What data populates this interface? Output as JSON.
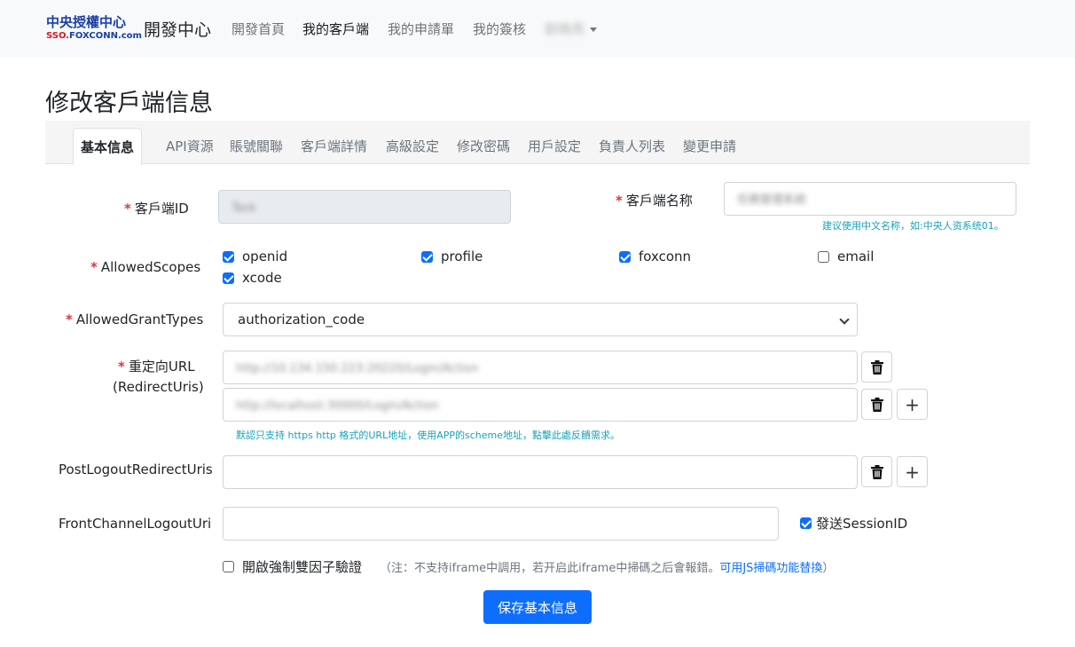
{
  "navbar": {
    "logo_line1": "中央授權中心",
    "logo_sso": "SSO.",
    "logo_domain": "FOXCONN.com",
    "brand": "開發中心",
    "links": [
      "開發首頁",
      "我的客戶端",
      "我的申請單",
      "我的簽核"
    ],
    "user": "劉曉燕"
  },
  "page_title": "修改客戶端信息",
  "tabs": [
    "基本信息",
    "API資源",
    "賬號關聯",
    "客戶端詳情",
    "高級設定",
    "修改密碼",
    "用戶設定",
    "負責人列表",
    "變更申請"
  ],
  "form": {
    "client_id": {
      "label": "客戶端ID",
      "value": "Task"
    },
    "client_name": {
      "label": "客戶端名称",
      "value": "任務管理系統",
      "hint": "建议使用中文名称，如:中央人资系统01。"
    },
    "scopes": {
      "label": "AllowedScopes",
      "items": [
        {
          "name": "openid",
          "checked": true
        },
        {
          "name": "profile",
          "checked": true
        },
        {
          "name": "foxconn",
          "checked": true
        },
        {
          "name": "email",
          "checked": false
        },
        {
          "name": "xcode",
          "checked": true
        }
      ]
    },
    "grant_types": {
      "label": "AllowedGrantTypes",
      "value": "authorization_code"
    },
    "redirect": {
      "label_line1": "重定向URL",
      "label_line2": "(RedirectUris)",
      "values": [
        "http://10.134.150.223:20220/Login/Action",
        "http://localhost:30000/Login/Action"
      ],
      "hint": "默認只支持 https http 格式的URL地址，使用APP的scheme地址，",
      "hint_link": "點擊此處反饋需求。"
    },
    "post_logout": {
      "label": "PostLogoutRedirectUris",
      "value": ""
    },
    "front_channel": {
      "label": "FrontChannelLogoutUri",
      "value": "",
      "session_label": "發送SessionID",
      "session_checked": true
    },
    "mfa": {
      "label": "開啟強制雙因子驗證",
      "note": "（注：不支持iframe中調用，若开启此iframe中掃碼之后會報錯。",
      "note_link": "可用JS掃碼功能替換",
      "note_end": "）",
      "checked": false
    },
    "save_label": "保存基本信息"
  }
}
